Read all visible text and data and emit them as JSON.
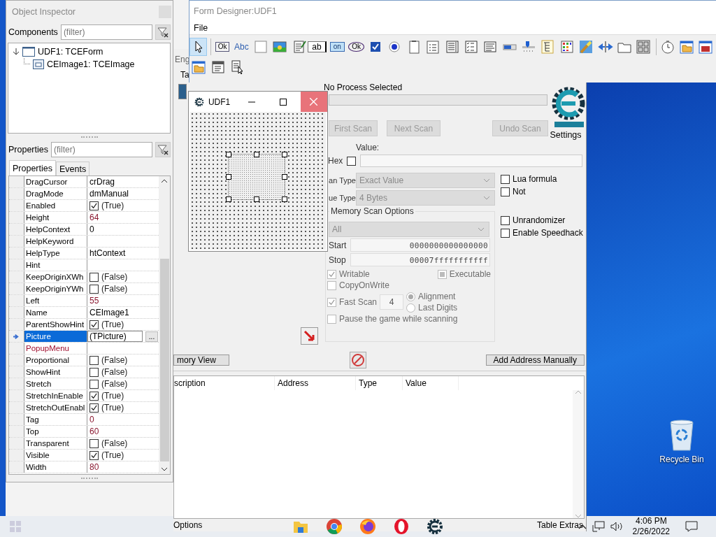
{
  "form_designer": {
    "title": "Form Designer:UDF1",
    "menu": [
      "File"
    ],
    "toolbar_rows": [
      [
        [
          {
            "kind": "pointer",
            "selected": true
          }
        ],
        [
          {
            "kind": "button",
            "label": "Ok",
            "selected": false
          },
          {
            "kind": "label",
            "label": "Abc",
            "selected": false
          },
          {
            "kind": "panel",
            "selected": false
          },
          {
            "kind": "image",
            "selected": false
          },
          {
            "kind": "memo",
            "selected": false
          },
          {
            "kind": "edit",
            "label": "ab",
            "selected": false
          },
          {
            "kind": "toggle",
            "label": "on",
            "selected": false
          },
          {
            "kind": "oval",
            "label": "Ok",
            "selected": false
          },
          {
            "kind": "checkbox",
            "selected": false
          },
          {
            "kind": "radio",
            "selected": false
          },
          {
            "kind": "page",
            "selected": false
          },
          {
            "kind": "list",
            "selected": false
          },
          {
            "kind": "listview",
            "selected": false
          },
          {
            "kind": "checklist",
            "selected": false
          },
          {
            "kind": "textlist",
            "selected": false
          },
          {
            "kind": "progress",
            "selected": false
          },
          {
            "kind": "trackbar",
            "selected": false
          },
          {
            "kind": "tree",
            "selected": false
          },
          {
            "kind": "grid",
            "selected": false
          },
          {
            "kind": "paint",
            "selected": false
          },
          {
            "kind": "splitter",
            "selected": false
          },
          {
            "kind": "tab",
            "selected": false
          },
          {
            "kind": "panels",
            "selected": false
          }
        ],
        [
          {
            "kind": "timer",
            "selected": false
          },
          {
            "kind": "opendialog",
            "selected": false
          },
          {
            "kind": "savedialog",
            "selected": false
          }
        ]
      ],
      [
        [
          {
            "kind": "opendialog",
            "selected": false
          },
          {
            "kind": "header",
            "selected": false
          },
          {
            "kind": "find",
            "selected": false
          }
        ]
      ]
    ]
  },
  "object_inspector": {
    "title": "Object Inspector",
    "components_label": "Components",
    "components_filter": {
      "placeholder": "(filter)"
    },
    "tree": [
      {
        "label": "UDF1: TCEForm",
        "expanded": true,
        "children": [
          {
            "label": "CEImage1: TCEImage"
          }
        ]
      }
    ],
    "properties_label": "Properties",
    "properties_filter": {
      "placeholder": "(filter)"
    },
    "tabs": [
      {
        "label": "Properties",
        "selected": true
      },
      {
        "label": "Events",
        "selected": false
      }
    ],
    "properties": [
      {
        "name": "DragCursor",
        "kind": "text",
        "value": "crDrag",
        "modified": false,
        "reference": false,
        "selected": false
      },
      {
        "name": "DragMode",
        "kind": "text",
        "value": "dmManual",
        "modified": false,
        "reference": false,
        "selected": false
      },
      {
        "name": "Enabled",
        "kind": "bool",
        "value": "(True)",
        "checked": true,
        "modified": false,
        "reference": false,
        "selected": false
      },
      {
        "name": "Height",
        "kind": "text",
        "value": "64",
        "modified": true,
        "reference": false,
        "selected": false
      },
      {
        "name": "HelpContext",
        "kind": "text",
        "value": "0",
        "modified": false,
        "reference": false,
        "selected": false
      },
      {
        "name": "HelpKeyword",
        "kind": "text",
        "reference": false,
        "selected": false
      },
      {
        "name": "HelpType",
        "kind": "text",
        "value": "htContext",
        "modified": false,
        "reference": false,
        "selected": false
      },
      {
        "name": "Hint",
        "kind": "text",
        "reference": false,
        "selected": false
      },
      {
        "name": "KeepOriginXWh",
        "kind": "bool",
        "value": "(False)",
        "checked": false,
        "modified": false,
        "reference": false,
        "selected": false
      },
      {
        "name": "KeepOriginYWh",
        "kind": "bool",
        "value": "(False)",
        "checked": false,
        "modified": false,
        "reference": false,
        "selected": false
      },
      {
        "name": "Left",
        "kind": "text",
        "value": "55",
        "modified": true,
        "reference": false,
        "selected": false
      },
      {
        "name": "Name",
        "kind": "text",
        "value": "CEImage1",
        "modified": false,
        "reference": false,
        "selected": false
      },
      {
        "name": "ParentShowHint",
        "kind": "bool",
        "value": "(True)",
        "checked": true,
        "modified": false,
        "reference": false,
        "selected": false
      },
      {
        "name": "Picture",
        "kind": "editor",
        "value": "(TPicture)",
        "button": "...",
        "modified": false,
        "reference": false,
        "selected": true
      },
      {
        "name": "PopupMenu",
        "kind": "text",
        "reference": true,
        "selected": false
      },
      {
        "name": "Proportional",
        "kind": "bool",
        "value": "(False)",
        "checked": false,
        "modified": false,
        "reference": false,
        "selected": false
      },
      {
        "name": "ShowHint",
        "kind": "bool",
        "value": "(False)",
        "checked": false,
        "modified": false,
        "reference": false,
        "selected": false
      },
      {
        "name": "Stretch",
        "kind": "bool",
        "value": "(False)",
        "checked": false,
        "modified": false,
        "reference": false,
        "selected": false
      },
      {
        "name": "StretchInEnable",
        "kind": "bool",
        "value": "(True)",
        "checked": true,
        "modified": false,
        "reference": false,
        "selected": false
      },
      {
        "name": "StretchOutEnabl",
        "kind": "bool",
        "value": "(True)",
        "checked": true,
        "modified": false,
        "reference": false,
        "selected": false
      },
      {
        "name": "Tag",
        "kind": "text",
        "value": "0",
        "modified": true,
        "reference": false,
        "selected": false
      },
      {
        "name": "Top",
        "kind": "text",
        "value": "60",
        "modified": true,
        "reference": false,
        "selected": false
      },
      {
        "name": "Transparent",
        "kind": "bool",
        "value": "(False)",
        "checked": false,
        "modified": false,
        "reference": false,
        "selected": false
      },
      {
        "name": "Visible",
        "kind": "bool",
        "value": "(True)",
        "checked": true,
        "modified": false,
        "reference": false,
        "selected": false
      },
      {
        "name": "Width",
        "kind": "text",
        "value": "80",
        "modified": true,
        "reference": false,
        "selected": false
      }
    ]
  },
  "form_window": {
    "title": "UDF1"
  },
  "main_window": {
    "header_fragments": [
      "Eng",
      "Ta"
    ],
    "process": "No Process Selected",
    "settings_label": "Settings",
    "scan_buttons": [
      {
        "label": "First Scan",
        "disabled": true
      },
      {
        "label": "Next Scan",
        "disabled": true
      },
      {
        "label": "Undo Scan",
        "disabled": true
      }
    ],
    "value_label": "Value:",
    "hex": {
      "label": "Hex",
      "checked": false
    },
    "scan_type": {
      "label": "an Type",
      "value": "Exact Value",
      "disabled": true
    },
    "value_type": {
      "label": "ue Type",
      "value": "4 Bytes",
      "disabled": true
    },
    "type_checks": [
      {
        "label": "Lua formula",
        "checked": false
      },
      {
        "label": "Not",
        "checked": false
      }
    ],
    "extra_checks": [
      {
        "label": "Unrandomizer",
        "checked": false
      },
      {
        "label": "Enable Speedhack",
        "checked": false
      }
    ],
    "memory_scan": {
      "title": "Memory Scan Options",
      "region": "All",
      "start_label": "Start",
      "start": "0000000000000000",
      "stop_label": "Stop",
      "stop": "00007fffffffffff",
      "writable": {
        "label": "Writable",
        "checked": true
      },
      "executable": {
        "label": "Executable",
        "indeterminate": true
      },
      "copy_on_write": {
        "label": "CopyOnWrite",
        "checked": false
      },
      "fast_scan": {
        "label": "Fast Scan",
        "checked": true,
        "value": "4"
      },
      "alignment": [
        {
          "label": "Alignment",
          "selected": true
        },
        {
          "label": "Last Digits",
          "selected": false
        }
      ],
      "pause": {
        "label": "Pause the game while scanning",
        "checked": false
      }
    },
    "memory_view_button": "mory View",
    "add_address_button": "Add Address Manually",
    "columns": [
      "scription",
      "Address",
      "Type",
      "Value"
    ],
    "status_left": "Options",
    "status_right": "Table Extras"
  },
  "desktop": {
    "icons": [
      {
        "label": "Recycle Bin"
      }
    ]
  },
  "taskbar": {
    "time": "4:06 PM",
    "date": "2/26/2022"
  }
}
